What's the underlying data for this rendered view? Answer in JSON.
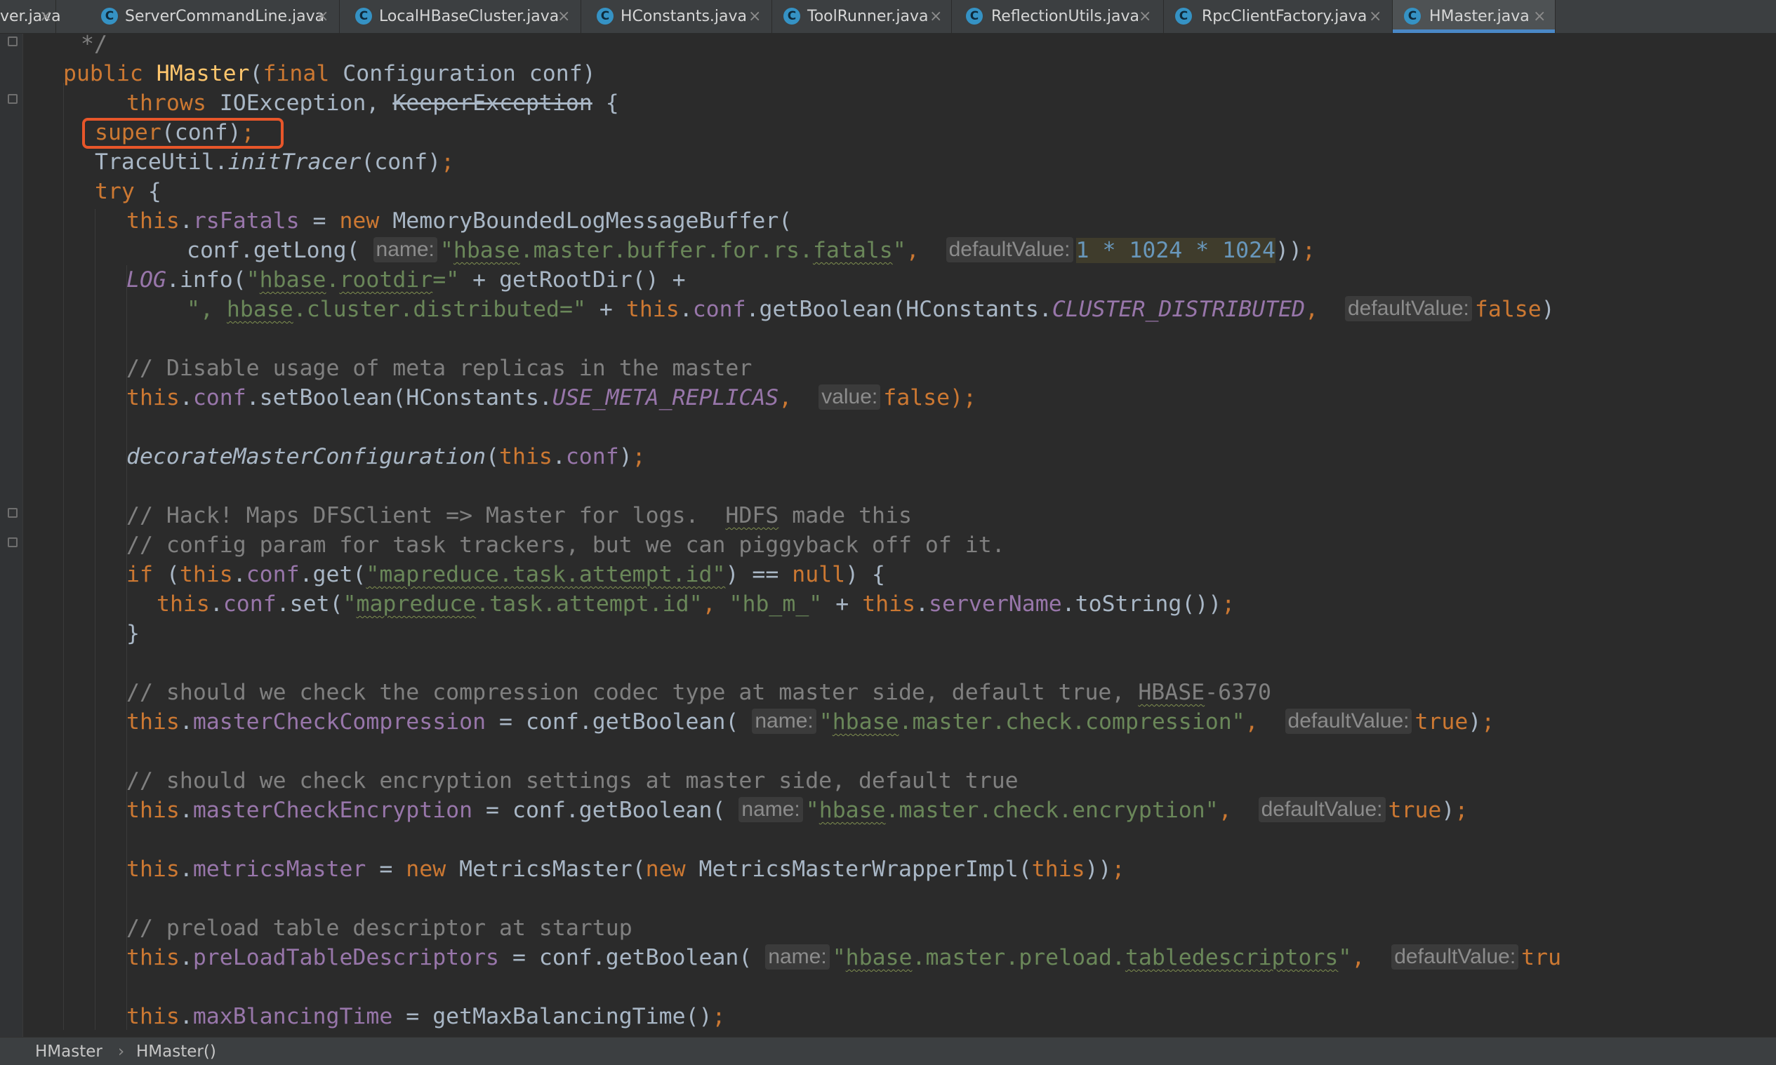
{
  "tabs": [
    {
      "label": "ver.java",
      "icon": "none"
    },
    {
      "label": "ServerCommandLine.java",
      "icon": "java-class-icon"
    },
    {
      "label": "LocalHBaseCluster.java",
      "icon": "java-class-icon"
    },
    {
      "label": "HConstants.java",
      "icon": "java-class-icon"
    },
    {
      "label": "ToolRunner.java",
      "icon": "java-class-icon"
    },
    {
      "label": "ReflectionUtils.java",
      "icon": "java-class-icon"
    },
    {
      "label": "RpcClientFactory.java",
      "icon": "java-class-icon"
    },
    {
      "label": "HMaster.java",
      "icon": "java-class-icon",
      "active": true
    }
  ],
  "tab_icon_glyph": "C",
  "close_glyph": "×",
  "code": {
    "l1": "*/",
    "l2": [
      "public",
      " ",
      "HMaster",
      "(",
      "final",
      " Configuration conf)"
    ],
    "l3": [
      "throws",
      " IOException, ",
      "KeeperException",
      " {"
    ],
    "l4": [
      "super",
      "(conf)",
      ";"
    ],
    "l5": [
      "TraceUtil.",
      "initTracer",
      "(conf)",
      ";"
    ],
    "l6": [
      "try",
      " {"
    ],
    "l7": [
      "this",
      ".",
      "rsFatals",
      " = ",
      "new",
      " MemoryBoundedLogMessageBuffer("
    ],
    "l8": [
      "conf.getLong( ",
      "name:",
      "\"",
      "hbase",
      ".master.buffer.for.rs.",
      "fatals",
      "\"",
      ",  ",
      "defaultValue:",
      "1 * 1024 * 1024",
      "))",
      ";"
    ],
    "l9": [
      "LOG",
      ".info(",
      "\"",
      "hbase",
      ".",
      "rootdir",
      "=\"",
      " + getRootDir() +"
    ],
    "l10": [
      "\", ",
      "hbase",
      ".cluster.distributed=\"",
      " + ",
      "this",
      ".",
      "conf",
      ".getBoolean(HConstants.",
      "CLUSTER_DISTRIBUTED",
      ",  ",
      "defaultValue:",
      "false",
      ")"
    ],
    "l11": "// Disable usage of meta replicas in the master",
    "l12": [
      "this",
      ".",
      "conf",
      ".setBoolean(HConstants.",
      "USE_META_REPLICAS",
      ",  ",
      "value:",
      "false",
      ");"
    ],
    "l13": [
      "decorateMasterConfiguration",
      "(",
      "this",
      ".",
      "conf",
      ")",
      ";"
    ],
    "l14": [
      "// Hack! Maps DFSClient => Master for logs.  ",
      "HDFS",
      " made this"
    ],
    "l15": "// config param for task trackers, but we can piggyback off of it.",
    "l16": [
      "if",
      " (",
      "this",
      ".",
      "conf",
      ".get(",
      "\"mapreduce.task.attempt.id\"",
      ") == ",
      "null",
      ") {"
    ],
    "l17": [
      "this",
      ".",
      "conf",
      ".set(",
      "\"",
      "mapreduce",
      ".task.attempt.id\"",
      ", ",
      "\"hb_m_\"",
      " + ",
      "this",
      ".",
      "serverName",
      ".toString())",
      ";"
    ],
    "l18": "}",
    "l19": [
      "// should we check the compression codec type at master side, default true, ",
      "HBASE",
      "-6370"
    ],
    "l20": [
      "this",
      ".",
      "masterCheckCompression",
      " = conf.getBoolean( ",
      "name:",
      "\"",
      "hbase",
      ".master.check.compression\"",
      ",  ",
      "defaultValue:",
      "true",
      ")",
      ";"
    ],
    "l21": "// should we check encryption settings at master side, default true",
    "l22": [
      "this",
      ".",
      "masterCheckEncryption",
      " = conf.getBoolean( ",
      "name:",
      "\"",
      "hbase",
      ".master.check.encryption\"",
      ",  ",
      "defaultValue:",
      "true",
      ")",
      ";"
    ],
    "l23": [
      "this",
      ".",
      "metricsMaster",
      " = ",
      "new",
      " MetricsMaster(",
      "new",
      " MetricsMasterWrapperImpl(",
      "this",
      "))",
      ";"
    ],
    "l24": "// preload table descriptor at startup",
    "l25": [
      "this",
      ".",
      "preLoadTableDescriptors",
      " = conf.getBoolean( ",
      "name:",
      "\"",
      "hbase",
      ".master.preload.",
      "tabledescriptors",
      "\"",
      ",  ",
      "defaultValue:",
      "tru"
    ],
    "l26": [
      "this",
      ".",
      "maxBlancingTime",
      " = getMaxBalancingTime()",
      ";"
    ]
  },
  "breadcrumb": {
    "class": "HMaster",
    "sep": "›",
    "method": "HMaster()"
  },
  "colors": {
    "keyword": "#cc7832",
    "field": "#9876aa",
    "string": "#6a8759",
    "number": "#6897bb",
    "comment": "#808080",
    "method_decl": "#ffc66d",
    "plain": "#a9b7c6",
    "highlight_box": "#e8562a",
    "active_tab_underline": "#4a88c7"
  }
}
